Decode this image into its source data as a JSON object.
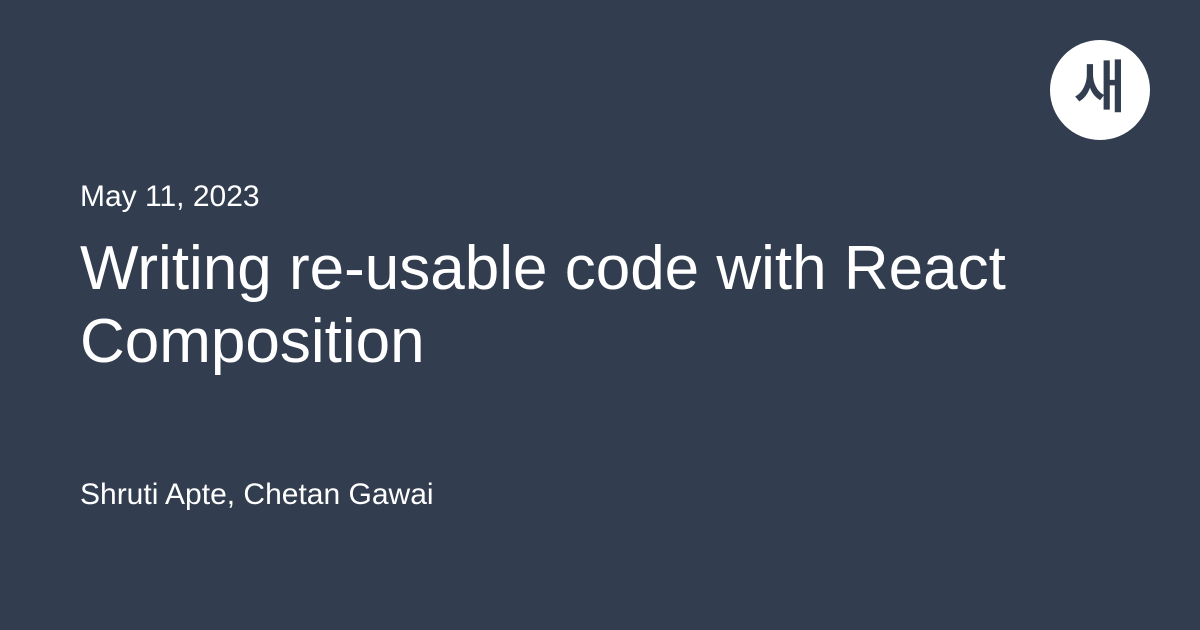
{
  "logo": {
    "text": "새"
  },
  "post": {
    "date": "May 11, 2023",
    "title": "Writing re-usable code with React Composition",
    "authors": "Shruti Apte, Chetan Gawai"
  }
}
